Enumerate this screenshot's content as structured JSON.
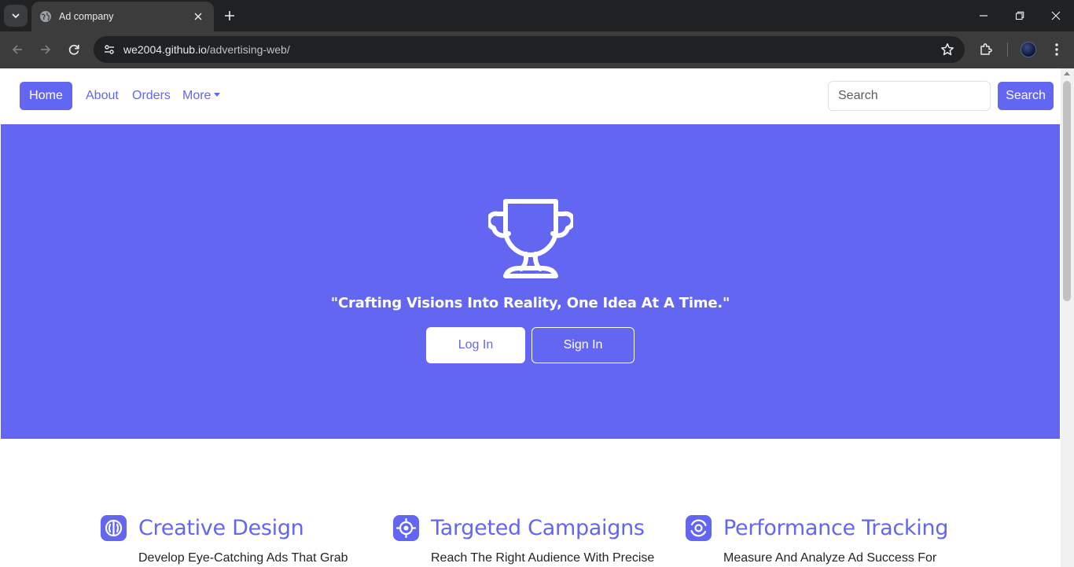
{
  "browser": {
    "tab_title": "Ad company",
    "url_host": "we2004.github.io",
    "url_path": "/advertising-web/"
  },
  "navbar": {
    "home_label": "Home",
    "about_label": "About",
    "orders_label": "Orders",
    "more_label": "More",
    "search_placeholder": "Search",
    "search_button_label": "Search"
  },
  "hero": {
    "icon": "trophy-icon",
    "tagline": "\"Crafting Visions Into Reality, One Idea At A Time.\"",
    "login_label": "Log In",
    "signin_label": "Sign In"
  },
  "features": [
    {
      "icon": "brain-icon",
      "title": "Creative Design",
      "description": "Develop Eye-Catching Ads That Grab"
    },
    {
      "icon": "target-icon",
      "title": "Targeted Campaigns",
      "description": "Reach The Right Audience With Precise"
    },
    {
      "icon": "analytics-icon",
      "title": "Performance Tracking",
      "description": "Measure And Analyze Ad Success For"
    }
  ],
  "colors": {
    "accent": "#6366f1",
    "chrome_dark": "#1f2122",
    "chrome_toolbar": "#3c3c3c"
  }
}
